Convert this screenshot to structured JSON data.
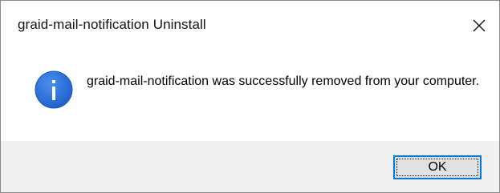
{
  "window": {
    "title": "graid-mail-notification Uninstall",
    "close_icon": "close-icon"
  },
  "message": {
    "icon": "info-icon",
    "icon_color": "#2b6fd6",
    "text": "graid-mail-notification was successfully removed from your computer."
  },
  "buttons": {
    "ok_label": "OK",
    "accent": "#0078d7"
  }
}
